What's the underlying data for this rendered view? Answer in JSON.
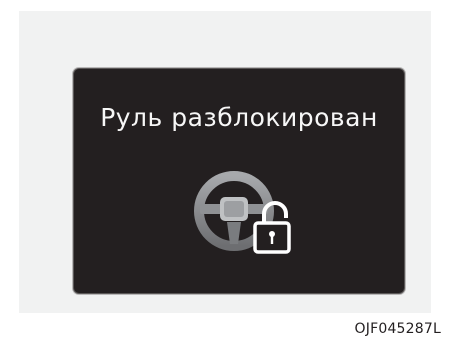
{
  "display": {
    "message": "Руль разблокирован",
    "icon": "steering-wheel-unlocked-icon",
    "background_color": "#231f20",
    "text_color": "#f7f7f7"
  },
  "figure": {
    "code": "OJF045287L"
  }
}
